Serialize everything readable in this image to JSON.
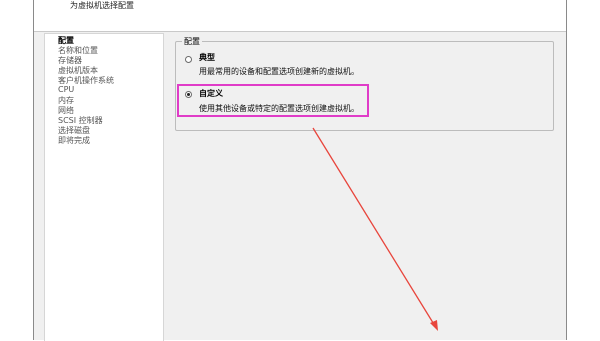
{
  "header": {
    "subtitle": "为虚拟机选择配置"
  },
  "sidebar": {
    "items": [
      {
        "label": "配置",
        "active": true
      },
      {
        "label": "名称和位置"
      },
      {
        "label": "存储器"
      },
      {
        "label": "虚拟机版本"
      },
      {
        "label": "客户机操作系统"
      },
      {
        "label": "CPU"
      },
      {
        "label": "内存"
      },
      {
        "label": "网络"
      },
      {
        "label": "SCSI 控制器"
      },
      {
        "label": "选择磁盘"
      },
      {
        "label": "即将完成"
      }
    ]
  },
  "config": {
    "group_title": "配置",
    "options": [
      {
        "title": "典型",
        "description": "用最常用的设备和配置选项创建新的虚拟机。",
        "selected": false
      },
      {
        "title": "自定义",
        "description": "使用其他设备或特定的配置选项创建虚拟机。",
        "selected": true
      }
    ]
  },
  "colors": {
    "highlight": "#e03cc8",
    "arrow": "#e8453c"
  }
}
